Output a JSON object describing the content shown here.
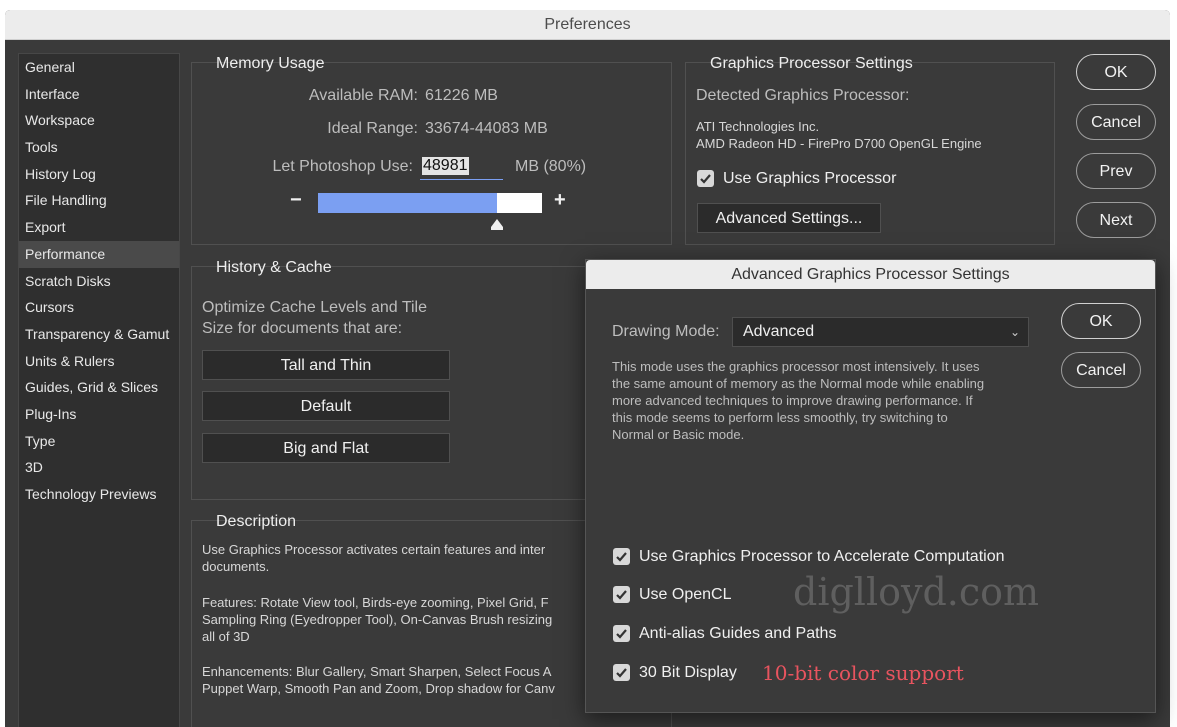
{
  "window": {
    "title": "Preferences"
  },
  "sidebar": {
    "items": [
      {
        "label": "General"
      },
      {
        "label": "Interface"
      },
      {
        "label": "Workspace"
      },
      {
        "label": "Tools"
      },
      {
        "label": "History Log"
      },
      {
        "label": "File Handling"
      },
      {
        "label": "Export"
      },
      {
        "label": "Performance"
      },
      {
        "label": "Scratch Disks"
      },
      {
        "label": "Cursors"
      },
      {
        "label": "Transparency & Gamut"
      },
      {
        "label": "Units & Rulers"
      },
      {
        "label": "Guides, Grid & Slices"
      },
      {
        "label": "Plug-Ins"
      },
      {
        "label": "Type"
      },
      {
        "label": "3D"
      },
      {
        "label": "Technology Previews"
      }
    ],
    "selected": "Performance"
  },
  "memory": {
    "title": "Memory Usage",
    "available_label": "Available RAM:",
    "available_value": "61226 MB",
    "ideal_label": "Ideal Range:",
    "ideal_value": "33674-44083 MB",
    "use_label": "Let Photoshop Use:",
    "use_value": "48981",
    "use_suffix": "MB (80%)",
    "minus": "−",
    "plus": "+",
    "slider_fraction": 0.8
  },
  "gpu": {
    "title": "Graphics Processor Settings",
    "detected_label": "Detected Graphics Processor:",
    "vendor": "ATI Technologies Inc.",
    "model": "AMD Radeon HD - FirePro D700 OpenGL Engine",
    "use_gpu_label": "Use Graphics Processor",
    "use_gpu_checked": true,
    "advanced_button": "Advanced Settings..."
  },
  "buttons": {
    "ok": "OK",
    "cancel": "Cancel",
    "prev": "Prev",
    "next": "Next"
  },
  "history": {
    "title": "History & Cache",
    "optimize_line1": "Optimize Cache Levels and Tile",
    "optimize_line2": "Size for documents that are:",
    "tall_thin": "Tall and Thin",
    "default": "Default",
    "big_flat": "Big and Flat"
  },
  "description": {
    "title": "Description",
    "para1_line1": "Use Graphics Processor activates certain features and inter",
    "para1_line2": "documents.",
    "para2_line1": "Features: Rotate View tool, Birds-eye zooming, Pixel Grid, F",
    "para2_line2": "Sampling Ring (Eyedropper Tool), On-Canvas Brush resizing",
    "para2_line3": "all of 3D",
    "para3_line1": "Enhancements: Blur Gallery, Smart Sharpen, Select Focus A",
    "para3_line2": "Puppet Warp, Smooth Pan and Zoom, Drop shadow for Canv"
  },
  "advanced_dialog": {
    "title": "Advanced Graphics Processor Settings",
    "drawing_mode_label": "Drawing Mode:",
    "drawing_mode_value": "Advanced",
    "mode_desc_line1": "This mode uses the graphics processor most intensively.  It uses",
    "mode_desc_line2": "the same amount of memory as the Normal mode while enabling",
    "mode_desc_line3": "more advanced techniques to improve drawing performance.  If",
    "mode_desc_line4": "this mode seems to perform less smoothly, try switching to",
    "mode_desc_line5": "Normal or Basic mode.",
    "ok": "OK",
    "cancel": "Cancel",
    "checkboxes": [
      {
        "label": "Use Graphics Processor to Accelerate Computation",
        "checked": true
      },
      {
        "label": "Use OpenCL",
        "checked": true
      },
      {
        "label": "Anti-alias Guides and Paths",
        "checked": true
      },
      {
        "label": "30 Bit Display",
        "checked": true
      }
    ],
    "watermark": "diglloyd.com",
    "annotation": "10-bit color support"
  },
  "colors": {
    "slider_fill": "#7b9ff2",
    "annotation": "#e8545f",
    "watermark": "#5f5f5f"
  }
}
